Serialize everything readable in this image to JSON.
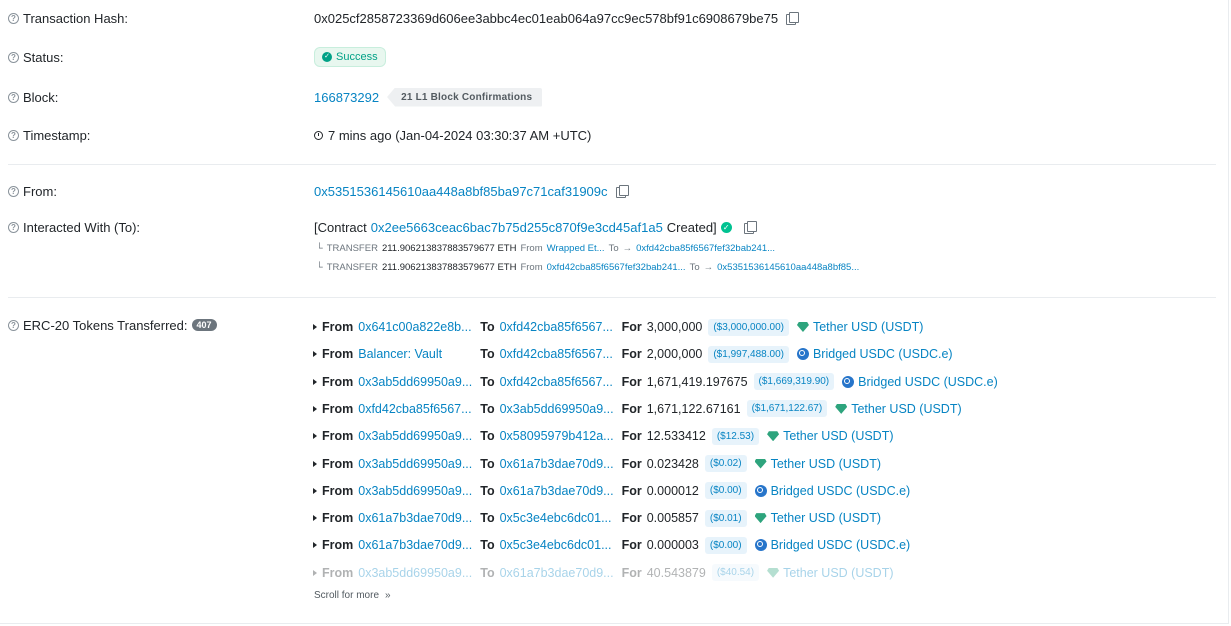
{
  "tx": {
    "hash_label": "Transaction Hash:",
    "hash_value": "0x025cf2858723369d606ee3abbc4ec01eab064a97cc9ec578bf91c6908679be75",
    "status_label": "Status:",
    "status_value": "Success",
    "block_label": "Block:",
    "block_value": "166873292",
    "block_confirmations": "21 L1 Block Confirmations",
    "timestamp_label": "Timestamp:",
    "timestamp_value": "7 mins ago (Jan-04-2024 03:30:37 AM +UTC)",
    "from_label": "From:",
    "from_value": "0x5351536145610aa448a8bf85ba97c71caf31909c",
    "to_label": "Interacted With (To):",
    "to_prefix": "[Contract",
    "to_contract": "0x2ee5663ceac6bac7b75d255c870f9e3cd45af1a5",
    "to_suffix": "Created]",
    "internal_transfers": [
      {
        "arrow": "└",
        "kind": "TRANSFER",
        "amount": "211.906213837883579677 ETH",
        "from_word": "From",
        "from": "Wrapped Et...",
        "to_word": "To",
        "to": "0xfd42cba85f6567fef32bab241..."
      },
      {
        "arrow": "└",
        "kind": "TRANSFER",
        "amount": "211.906213837883579677 ETH",
        "from_word": "From",
        "from": "0xfd42cba85f6567fef32bab241...",
        "to_word": "To",
        "to": "0x5351536145610aa448a8bf85..."
      }
    ],
    "erc20_label": "ERC-20 Tokens Transferred:",
    "erc20_count": "407",
    "scroll_more": "Scroll for more"
  },
  "tokens": [
    {
      "from": "0x641c00a822e8b...",
      "to": "0xfd42cba85f6567...",
      "amount": "3,000,000",
      "usd": "($3,000,000.00)",
      "token": "Tether USD (USDT)",
      "icon": "tether"
    },
    {
      "from": "Balancer: Vault",
      "to": "0xfd42cba85f6567...",
      "amount": "2,000,000",
      "usd": "($1,997,488.00)",
      "token": "Bridged USDC (USDC.e)",
      "icon": "usdc"
    },
    {
      "from": "0x3ab5dd69950a9...",
      "to": "0xfd42cba85f6567...",
      "amount": "1,671,419.197675",
      "usd": "($1,669,319.90)",
      "token": "Bridged USDC (USDC.e)",
      "icon": "usdc"
    },
    {
      "from": "0xfd42cba85f6567...",
      "to": "0x3ab5dd69950a9...",
      "amount": "1,671,122.67161",
      "usd": "($1,671,122.67)",
      "token": "Tether USD (USDT)",
      "icon": "tether"
    },
    {
      "from": "0x3ab5dd69950a9...",
      "to": "0x58095979b412a...",
      "amount": "12.533412",
      "usd": "($12.53)",
      "token": "Tether USD (USDT)",
      "icon": "tether"
    },
    {
      "from": "0x3ab5dd69950a9...",
      "to": "0x61a7b3dae70d9...",
      "amount": "0.023428",
      "usd": "($0.02)",
      "token": "Tether USD (USDT)",
      "icon": "tether"
    },
    {
      "from": "0x3ab5dd69950a9...",
      "to": "0x61a7b3dae70d9...",
      "amount": "0.000012",
      "usd": "($0.00)",
      "token": "Bridged USDC (USDC.e)",
      "icon": "usdc"
    },
    {
      "from": "0x61a7b3dae70d9...",
      "to": "0x5c3e4ebc6dc01...",
      "amount": "0.005857",
      "usd": "($0.01)",
      "token": "Tether USD (USDT)",
      "icon": "tether"
    },
    {
      "from": "0x61a7b3dae70d9...",
      "to": "0x5c3e4ebc6dc01...",
      "amount": "0.000003",
      "usd": "($0.00)",
      "token": "Bridged USDC (USDC.e)",
      "icon": "usdc"
    },
    {
      "from": "0x3ab5dd69950a9...",
      "to": "0x61a7b3dae70d9...",
      "amount": "40.543879",
      "usd": "($40.54)",
      "token": "Tether USD (USDT)",
      "icon": "tether"
    }
  ],
  "words": {
    "from": "From",
    "to": "To",
    "for": "For"
  }
}
